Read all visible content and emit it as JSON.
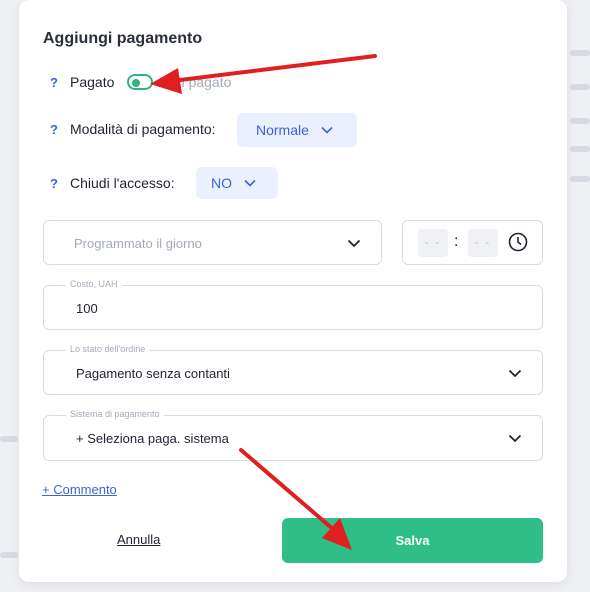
{
  "modal": {
    "title": "Aggiungi pagamento",
    "help_symbol": "?",
    "paid_toggle": {
      "label": "Pagato",
      "off_label": "Non pagato",
      "checked": true,
      "accent": "#2fb57e"
    },
    "payment_mode": {
      "label": "Modalità di pagamento:",
      "value": "Normale"
    },
    "close_access": {
      "label": "Chiudi l'accesso:",
      "value": "NO"
    },
    "scheduled": {
      "placeholder": "Programmato il giorno"
    },
    "time": {
      "hours": "- -",
      "minutes": "- -",
      "separator": ":"
    },
    "cost": {
      "legend": "Costo, UAH",
      "value": "100"
    },
    "order_status": {
      "legend": "Lo stato dell'ordine",
      "value": "Pagamento senza contanti"
    },
    "payment_system": {
      "legend": "Sistema di pagamento",
      "value": "+ Seleziona paga. sistema"
    },
    "comment_link": "+ Commento",
    "cancel_label": "Annulla",
    "save_label": "Salva",
    "save_color": "#2fbf86"
  },
  "annotation_color": "#e02020"
}
